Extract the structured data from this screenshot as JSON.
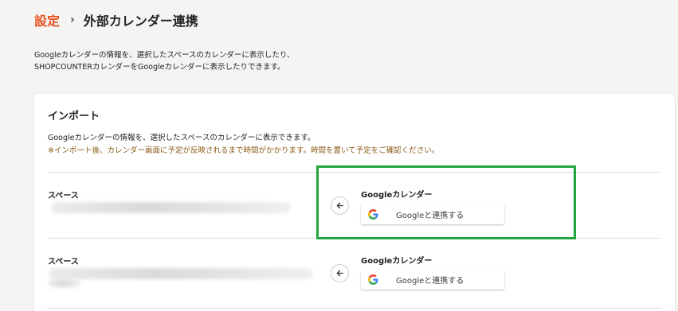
{
  "breadcrumb": {
    "parent": "設定",
    "separator": "›",
    "current": "外部カレンダー連携"
  },
  "description": {
    "line1": "Googleカレンダーの情報を、選択したスペースのカレンダーに表示したり、",
    "line2": "SHOPCOUNTERカレンダーをGoogleカレンダーに表示したりできます。"
  },
  "import": {
    "title": "インポート",
    "desc": "Googleカレンダーの情報を、選択したスペースのカレンダーに表示できます。",
    "note": "※インポート後、カレンダー画面に予定が反映されるまで時間がかかります。時間を置いて予定をご確認ください。",
    "rows": [
      {
        "space_label": "スペース",
        "gcal_label": "Googleカレンダー",
        "connect_label": "Googleと連携する"
      },
      {
        "space_label": "スペース",
        "gcal_label": "Googleカレンダー",
        "connect_label": "Googleと連携する"
      }
    ]
  },
  "colors": {
    "accent": "#e8501e",
    "highlight": "#21a63f",
    "note": "#8a5a14"
  }
}
